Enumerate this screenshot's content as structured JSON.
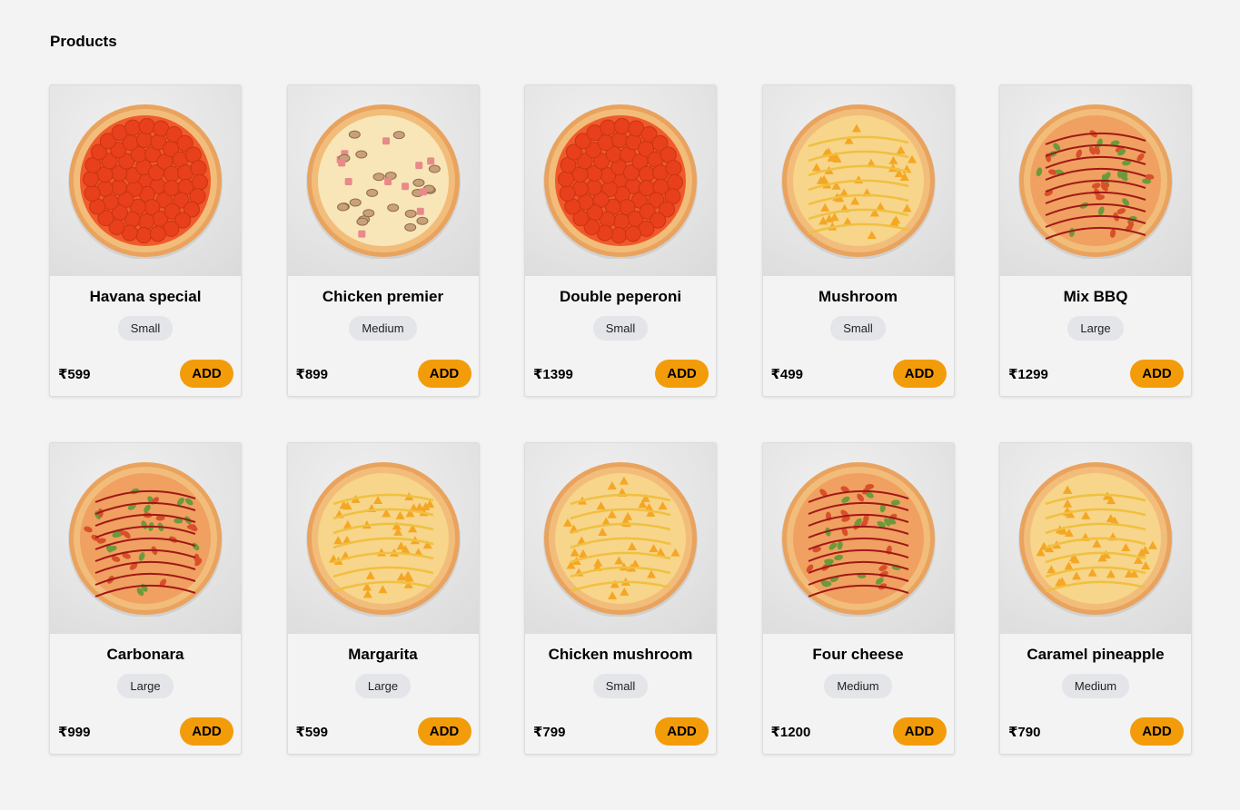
{
  "page": {
    "title": "Products"
  },
  "products": [
    {
      "name": "Havana special",
      "size": "Small",
      "price": "₹599",
      "add_label": "ADD",
      "topping": "pepperoni"
    },
    {
      "name": "Chicken premier",
      "size": "Medium",
      "price": "₹899",
      "add_label": "ADD",
      "topping": "chicken-mushroom"
    },
    {
      "name": "Double peperoni",
      "size": "Small",
      "price": "₹1399",
      "add_label": "ADD",
      "topping": "pepperoni"
    },
    {
      "name": "Mushroom",
      "size": "Small",
      "price": "₹499",
      "add_label": "ADD",
      "topping": "cheese-pineapple"
    },
    {
      "name": "Mix BBQ",
      "size": "Large",
      "price": "₹1299",
      "add_label": "ADD",
      "topping": "bbq"
    },
    {
      "name": "Carbonara",
      "size": "Large",
      "price": "₹999",
      "add_label": "ADD",
      "topping": "bbq"
    },
    {
      "name": "Margarita",
      "size": "Large",
      "price": "₹599",
      "add_label": "ADD",
      "topping": "cheese-pineapple"
    },
    {
      "name": "Chicken mushroom",
      "size": "Small",
      "price": "₹799",
      "add_label": "ADD",
      "topping": "cheese-pineapple"
    },
    {
      "name": "Four cheese",
      "size": "Medium",
      "price": "₹1200",
      "add_label": "ADD",
      "topping": "bbq"
    },
    {
      "name": "Caramel pineapple",
      "size": "Medium",
      "price": "₹790",
      "add_label": "ADD",
      "topping": "cheese-pineapple"
    }
  ],
  "colors": {
    "accent": "#f39c0a",
    "badge": "#e4e5e9",
    "background": "#f3f3f3"
  }
}
